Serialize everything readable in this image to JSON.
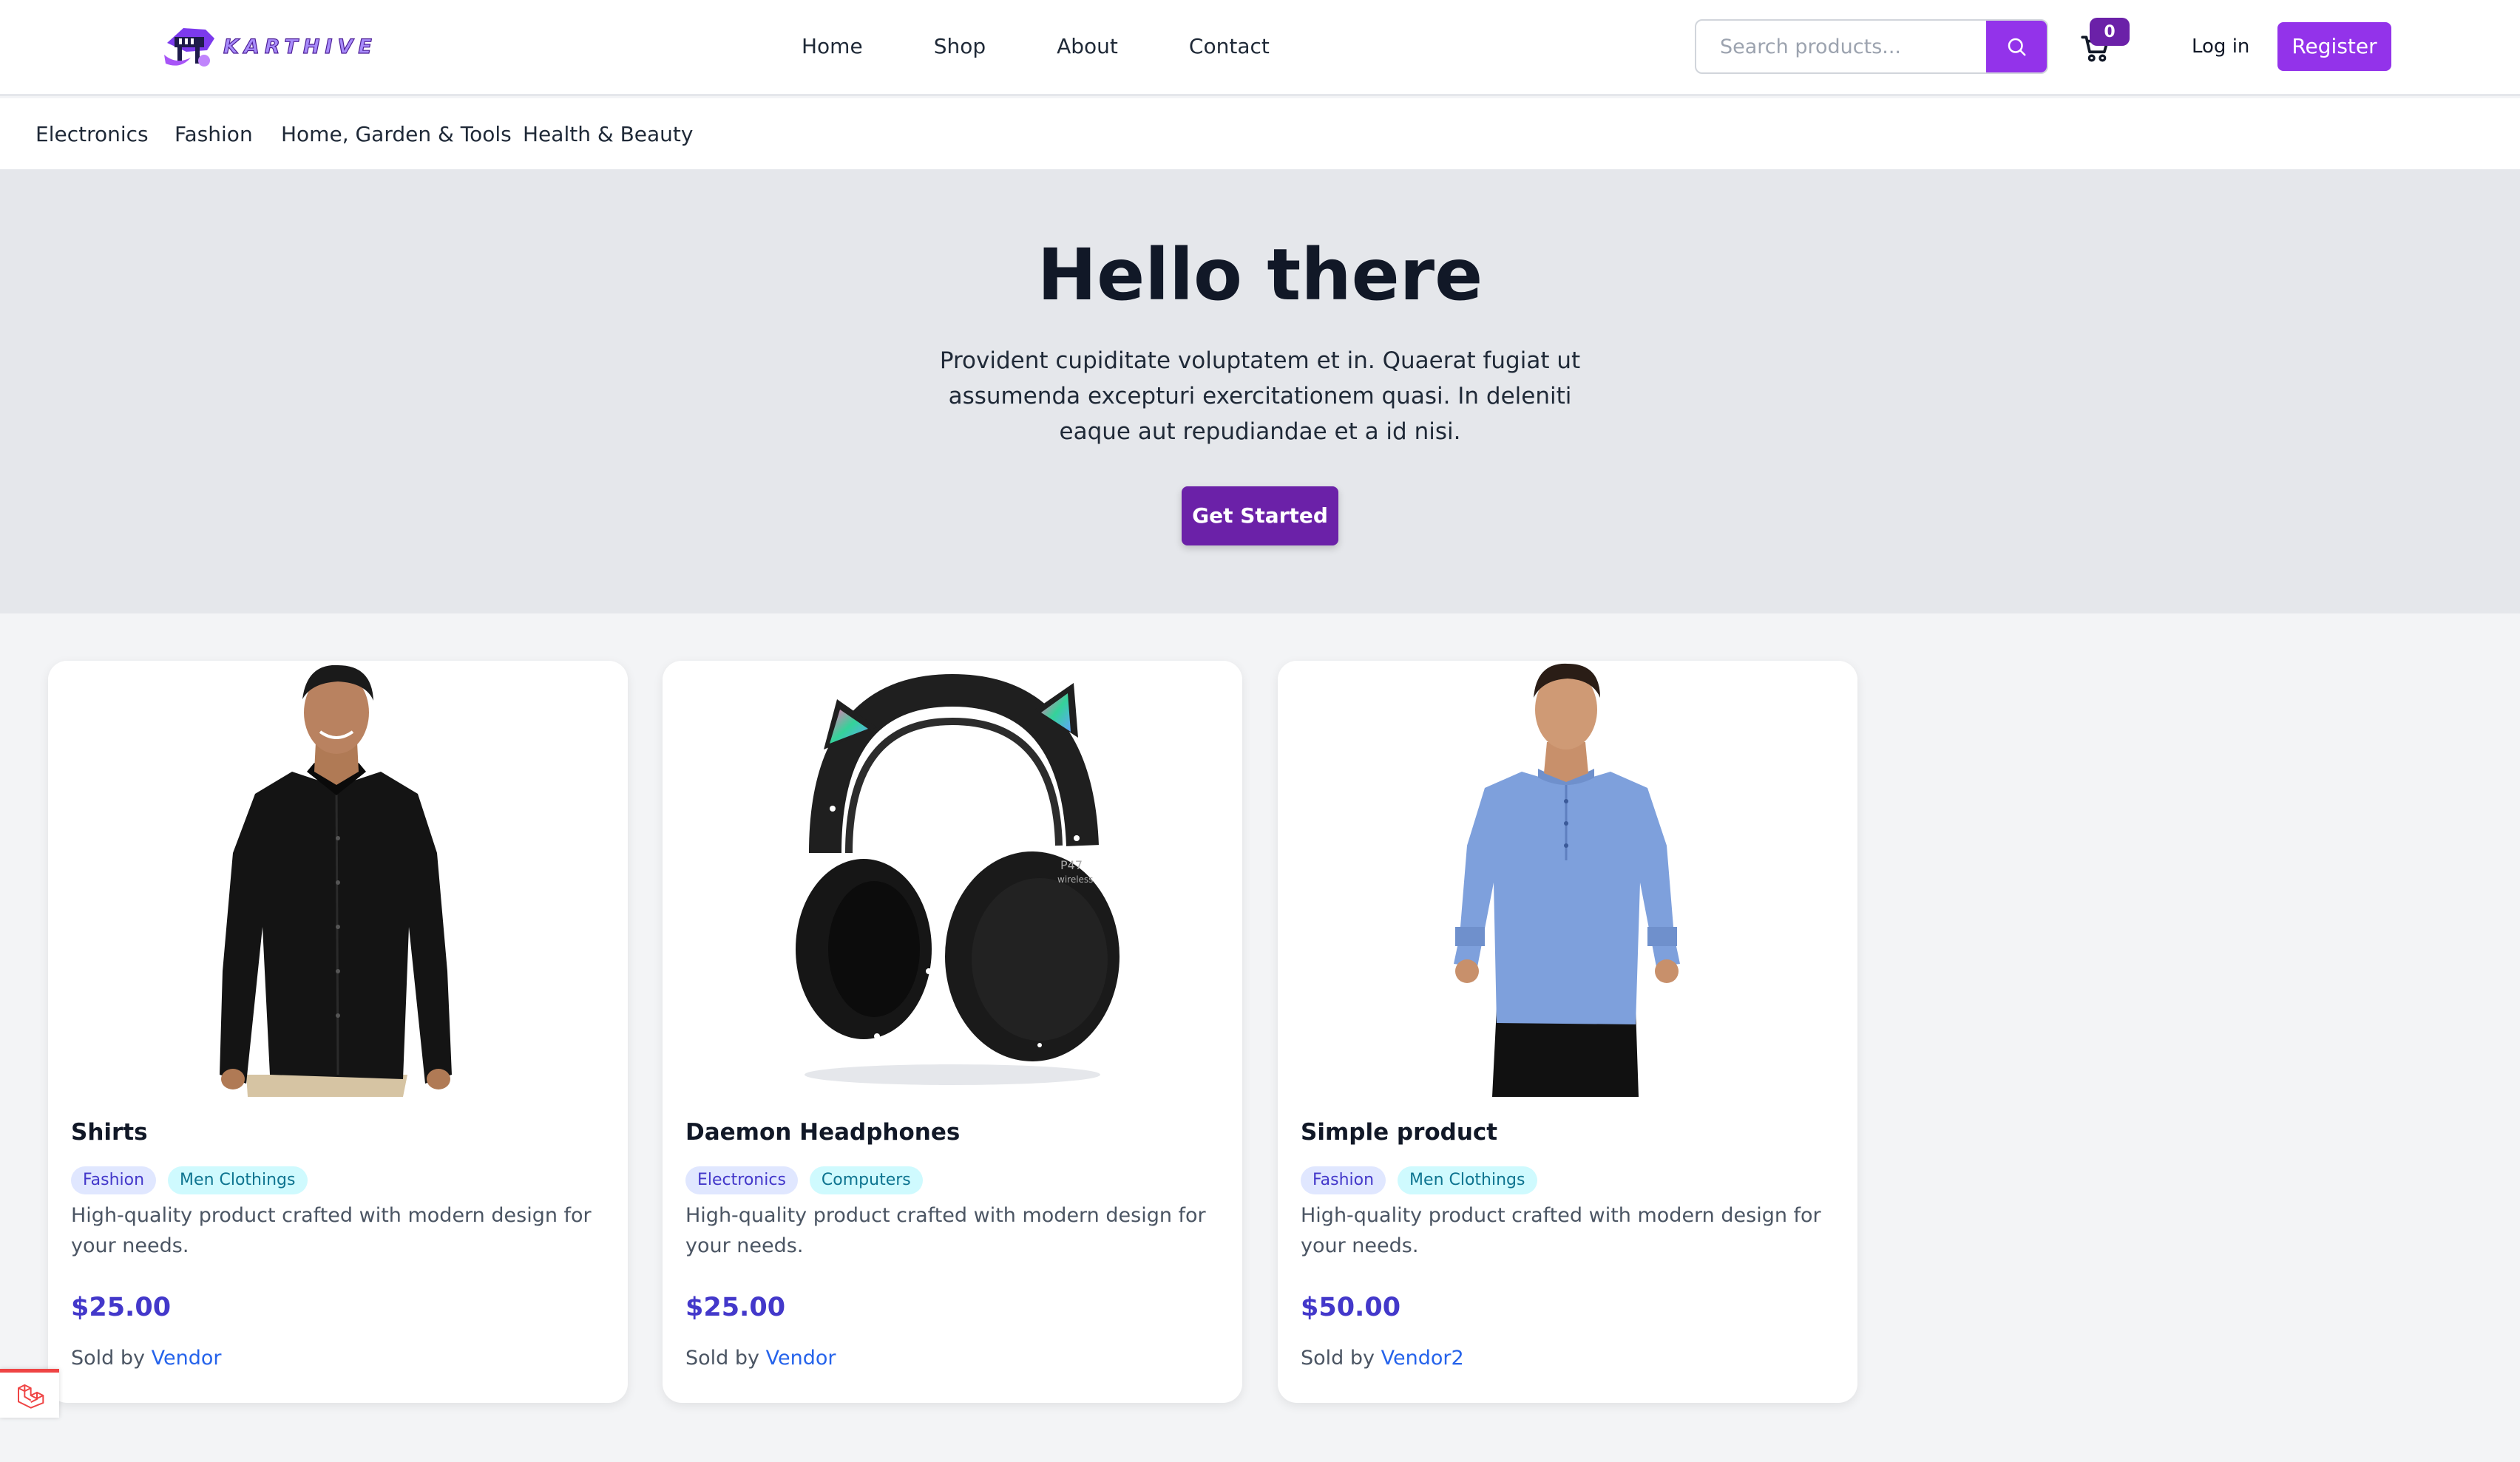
{
  "brand": {
    "name": "KARTHIVE",
    "accent": "#9333ea",
    "dark_accent": "#6b21a8"
  },
  "nav": {
    "items": [
      {
        "label": "Home"
      },
      {
        "label": "Shop"
      },
      {
        "label": "About"
      },
      {
        "label": "Contact"
      }
    ]
  },
  "search": {
    "placeholder": "Search products...",
    "icon": "search-icon"
  },
  "cart": {
    "count": "0",
    "icon": "cart-icon"
  },
  "auth": {
    "login_label": "Log in",
    "register_label": "Register"
  },
  "categories": [
    {
      "label": "Electronics"
    },
    {
      "label": "Fashion"
    },
    {
      "label": "Home, Garden & Tools"
    },
    {
      "label": "Health & Beauty"
    }
  ],
  "hero": {
    "title": "Hello there",
    "text": "Provident cupiditate voluptatem et in. Quaerat fugiat ut assumenda excepturi exercitationem quasi. In deleniti eaque aut repudiandae et a id nisi.",
    "cta_label": "Get Started"
  },
  "products": [
    {
      "name": "Shirts",
      "tags": [
        "Fashion",
        "Men Clothings"
      ],
      "description": "High-quality product crafted with modern design for your needs.",
      "price": "$25.00",
      "sold_by_label": "Sold by",
      "vendor": "Vendor",
      "image": "black-shirt-model"
    },
    {
      "name": "Daemon Headphones",
      "tags": [
        "Electronics",
        "Computers"
      ],
      "description": "High-quality product crafted with modern design for your needs.",
      "price": "$25.00",
      "sold_by_label": "Sold by",
      "vendor": "Vendor",
      "image": "cat-ear-headphones",
      "image_text": [
        "P47",
        "wireless"
      ]
    },
    {
      "name": "Simple product",
      "tags": [
        "Fashion",
        "Men Clothings"
      ],
      "description": "High-quality product crafted with modern design for your needs.",
      "price": "$50.00",
      "sold_by_label": "Sold by",
      "vendor": "Vendor2",
      "image": "blue-shirt-model"
    }
  ],
  "debug_widget": {
    "icon": "laravel-logo-icon"
  }
}
